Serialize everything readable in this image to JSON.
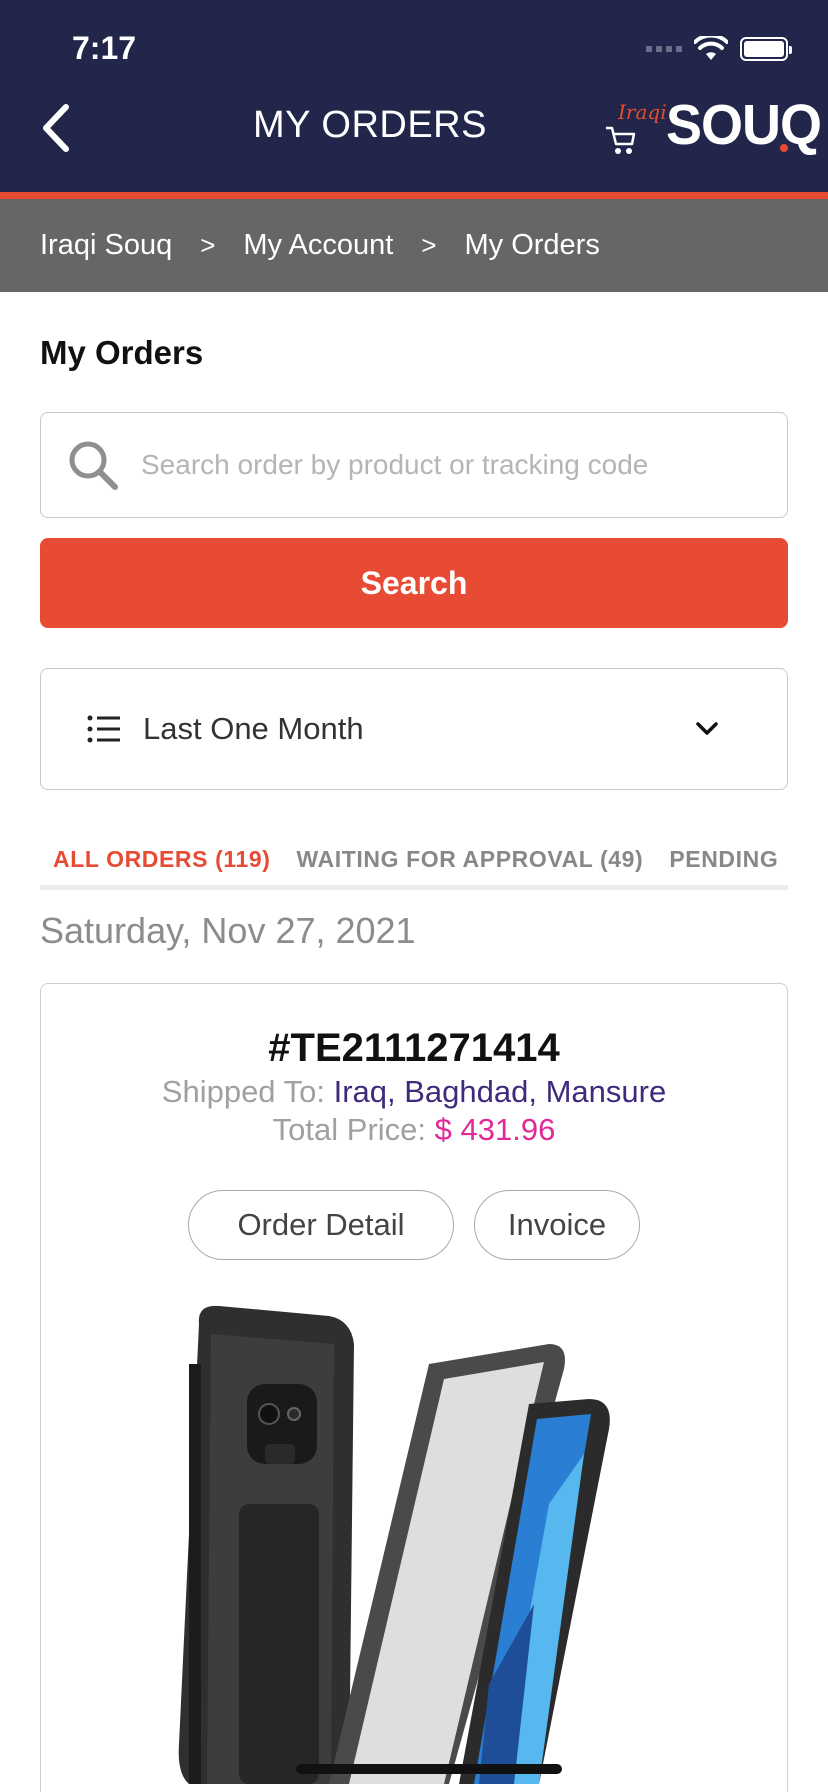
{
  "status_bar": {
    "time": "7:17"
  },
  "header": {
    "title": "MY ORDERS",
    "logo_small": "Iraqi",
    "logo_large": "SOUQ"
  },
  "breadcrumb": [
    "Iraqi Souq",
    "My Account",
    "My Orders"
  ],
  "breadcrumb_separator": ">",
  "page_title": "My Orders",
  "search": {
    "placeholder": "Search order by product or tracking code",
    "value": "",
    "button_label": "Search"
  },
  "filter": {
    "selected": "Last One Month"
  },
  "tabs": [
    {
      "label": "ALL ORDERS (119)",
      "active": true
    },
    {
      "label": "WAITING FOR APPROVAL (49)",
      "active": false
    },
    {
      "label": "PENDING",
      "active": false
    }
  ],
  "date_heading": "Saturday, Nov 27, 2021",
  "order": {
    "number": "#TE2111271414",
    "shipped_label": "Shipped To:",
    "shipped_value": "Iraq, Baghdad, Mansure",
    "price_label": "Total Price:",
    "price_value": "$ 431.96",
    "detail_button": "Order Detail",
    "invoice_button": "Invoice"
  },
  "colors": {
    "header_bg": "#21264a",
    "accent": "#e84b33",
    "breadcrumb_bg": "#666666",
    "shipped_text": "#3f2a7c",
    "price_text": "#e12a98"
  },
  "icons": [
    "back-chevron-icon",
    "wifi-icon",
    "battery-icon",
    "cart-icon",
    "search-icon",
    "list-icon",
    "chevron-down-icon"
  ]
}
